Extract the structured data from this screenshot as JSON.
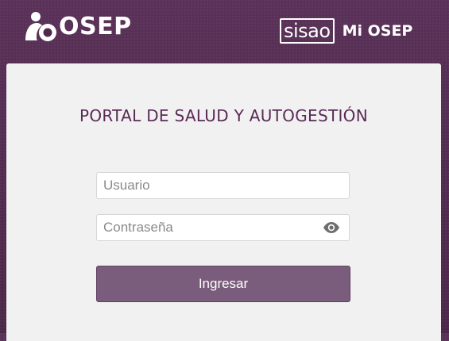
{
  "header": {
    "logo_text": "OSEP",
    "logo_icon": "osep-person-icon",
    "sisao_label": "sisao",
    "mi_osep_label": "Mi OSEP"
  },
  "login": {
    "title": "PORTAL DE SALUD Y AUTOGESTIÓN",
    "username_placeholder": "Usuario",
    "username_value": "",
    "password_placeholder": "Contraseña",
    "password_value": "",
    "password_toggle_icon": "eye-icon",
    "submit_label": "Ingresar"
  },
  "colors": {
    "background": "#4e2a4d",
    "title": "#5a2a57",
    "button": "#7a5d7c"
  }
}
